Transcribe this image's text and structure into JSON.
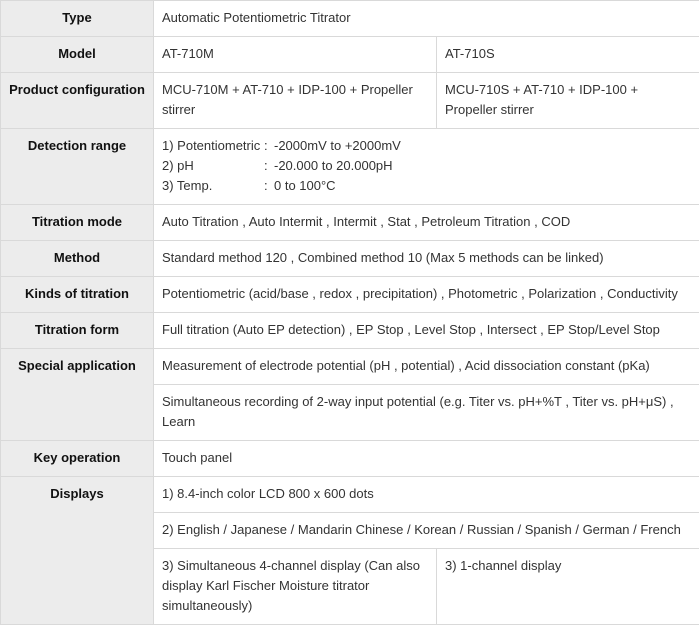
{
  "rows": [
    {
      "header": "Type",
      "value": "Automatic Potentiometric Titrator"
    },
    {
      "header": "Model",
      "col1": "AT-710M",
      "col2": "AT-710S"
    },
    {
      "header": "Product configuration",
      "col1": "MCU-710M + AT-710 + IDP-100 + Propeller stirrer",
      "col2": "MCU-710S + AT-710 + IDP-100 + Propeller stirrer"
    },
    {
      "header": "Detection range",
      "lines": [
        {
          "label": "1) Potentiometric",
          "sep": ":",
          "value": "-2000mV to +2000mV"
        },
        {
          "label": "2) pH",
          "sep": ":",
          "value": "-20.000 to 20.000pH"
        },
        {
          "label": "3) Temp.",
          "sep": ":",
          "value": "0 to 100°C"
        }
      ]
    },
    {
      "header": "Titration mode",
      "value": "Auto Titration , Auto Intermit , Intermit , Stat , Petroleum Titration , COD"
    },
    {
      "header": "Method",
      "value": "Standard method 120 , Combined method 10 (Max 5 methods can be linked)"
    },
    {
      "header": "Kinds of titration",
      "value": "Potentiometric (acid/base , redox , precipitation) , Photometric , Polarization , Conductivity"
    },
    {
      "header": "Titration form",
      "value": "Full titration (Auto EP detection) , EP Stop , Level Stop , Intersect , EP Stop/Level Stop"
    },
    {
      "header": "Special application",
      "sub": [
        "Measurement of electrode potential (pH , potential) , Acid dissociation constant (pKa)",
        "Simultaneous recording of 2-way input potential (e.g. Titer vs. pH+%T , Titer vs. pH+μS) , Learn"
      ]
    },
    {
      "header": "Key operation",
      "value": "Touch panel"
    },
    {
      "header": "Displays",
      "sub1": "1) 8.4-inch color LCD 800 x 600 dots",
      "sub2": "2) English / Japanese / Mandarin Chinese / Korean / Russian / Spanish / German / French",
      "col1": "3) Simultaneous 4-channel display (Can also display Karl Fischer Moisture titrator simultaneously)",
      "col2": "3) 1-channel display"
    }
  ]
}
